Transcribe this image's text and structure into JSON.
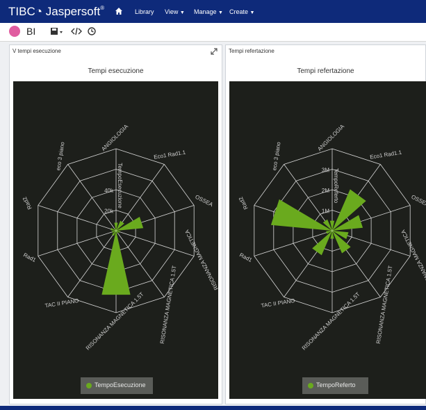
{
  "app": {
    "brand_prefix": "TIBC",
    "brand_rest": "Jaspersoft",
    "brand_reg": "®",
    "nav": {
      "library": "Library",
      "view": "View",
      "manage": "Manage",
      "create": "Create"
    }
  },
  "toolbar": {
    "bi_label": "BI",
    "icons": [
      "save-icon",
      "code-icon",
      "history-icon"
    ]
  },
  "colors": {
    "topbar": "#0e2a7a",
    "chart_bg": "#1d1f1b",
    "series": "#6aaa1e",
    "grid": "#d8d8d8"
  },
  "dashlets": [
    {
      "panel_title": "V tempi esecuzione",
      "chart_title": "Tempi esecuzione",
      "legend": "TempoEsecuzione",
      "axis_label": "TempoEsecuzione"
    },
    {
      "panel_title": "Tempi refertazione",
      "chart_title": "Tempi refertazione",
      "legend": "TempoReferto",
      "axis_label": "TempoReferto"
    }
  ],
  "chart_data": [
    {
      "type": "radar",
      "title": "Tempi esecuzione",
      "categories": [
        "ANGIOLOGIA",
        "Eco1 Rad1.1",
        "OSSEA",
        "RISONANZA MAGNETICA",
        "RISONANZA MAGNETICA 1.5T",
        "RISONANZA MAGNETICA 1.5T",
        "TAC II PIANO",
        "Rad1",
        "Rad2",
        "eco 3 piano"
      ],
      "series": [
        {
          "name": "TempoEsecuzione",
          "values": [
            6000,
            8000,
            20000,
            3000,
            2000,
            48000,
            4000,
            3000,
            4000,
            2000
          ]
        }
      ],
      "radial_ticks": [
        "20k",
        "40k"
      ],
      "ylim": [
        0,
        60000
      ]
    },
    {
      "type": "radar",
      "title": "Tempi refertazione",
      "categories": [
        "ANGIOLOGIA",
        "Eco1 Rad1.1",
        "OSSEA",
        "RISONANZA MAGNETICA",
        "RISONANZA MAGNETICA 1.5T",
        "RISONANZA MAGNETICA 1.5T",
        "TAC II PIANO",
        "Rad1",
        "Rad2",
        "eco 3 piano"
      ],
      "series": [
        {
          "name": "TempoReferto",
          "values": [
            500000,
            2200000,
            1500000,
            800000,
            1200000,
            400000,
            1300000,
            300000,
            3000000,
            600000
          ]
        }
      ],
      "radial_ticks": [
        "1M",
        "2M",
        "3M"
      ],
      "ylim": [
        0,
        4000000
      ]
    }
  ]
}
